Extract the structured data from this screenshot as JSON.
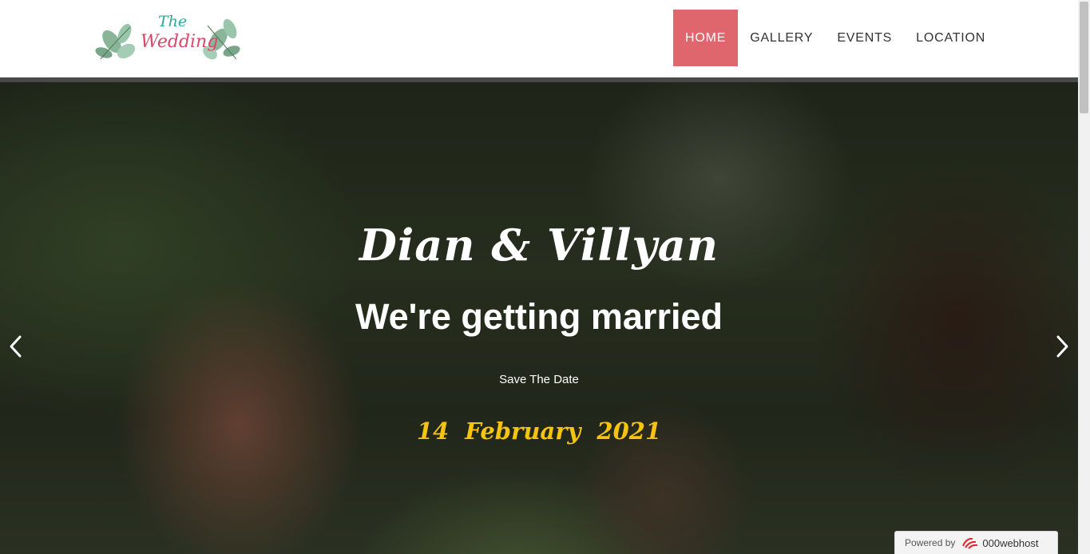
{
  "logo": {
    "line1": "The",
    "line2": "Wedding"
  },
  "nav": {
    "items": [
      {
        "label": "HOME",
        "active": true
      },
      {
        "label": "GALLERY",
        "active": false
      },
      {
        "label": "EVENTS",
        "active": false
      },
      {
        "label": "LOCATION",
        "active": false
      }
    ]
  },
  "hero": {
    "names": "Dian  &  Villyan",
    "subtitle": "We're getting married",
    "save_the_date": "Save The Date",
    "date": "14 February 2021"
  },
  "footer_badge": {
    "label": "Powered by",
    "brand": "000webhost"
  },
  "colors": {
    "accent": "#e0666e",
    "date": "#f5c40e"
  }
}
